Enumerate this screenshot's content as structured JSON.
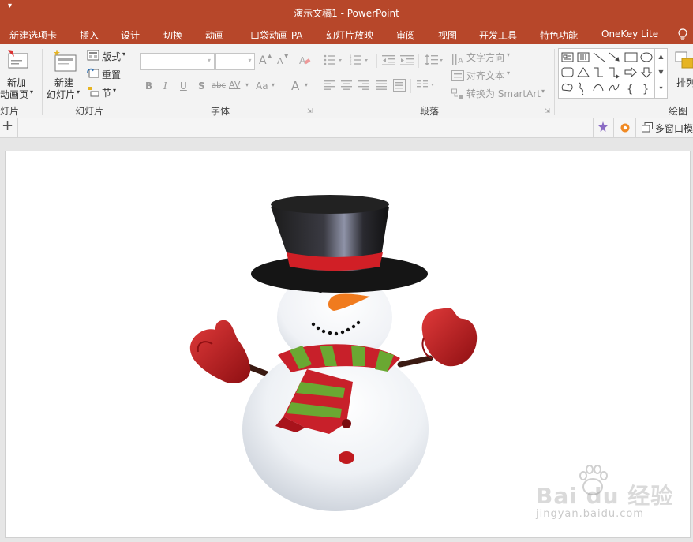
{
  "app": {
    "title": "演示文稿1 - PowerPoint",
    "accent": "#b7472a"
  },
  "tabs": [
    "新建选项卡",
    "插入",
    "设计",
    "切换",
    "动画",
    "口袋动画 PA",
    "幻灯片放映",
    "审阅",
    "视图",
    "开发工具",
    "特色功能",
    "OneKey Lite"
  ],
  "ribbon": {
    "new_anim_page": [
      "新加",
      "动画页"
    ],
    "new_slide": [
      "新建",
      "幻灯片"
    ],
    "layout": "版式",
    "reset": "重置",
    "section": "节",
    "font_grow": "A",
    "font_shrink": "A",
    "bold": "B",
    "italic": "I",
    "underline": "U",
    "shadow": "S",
    "strike": "abc",
    "spacing": "AV",
    "case": "Aa",
    "font_color": "A",
    "text_direction": "文字方向",
    "align_text": "对齐文本",
    "convert_smartart": "转换为 SmartArt",
    "arrange": "排列",
    "groups": {
      "slides_left": "灯片",
      "slides": "幻灯片",
      "font": "字体",
      "paragraph": "段落",
      "drawing": "绘图"
    }
  },
  "cmdstrip": {
    "add": "+",
    "multi_window": "多窗口模"
  },
  "watermark": {
    "brand": "Bai du 经验",
    "url": "jingyan.baidu.com"
  }
}
